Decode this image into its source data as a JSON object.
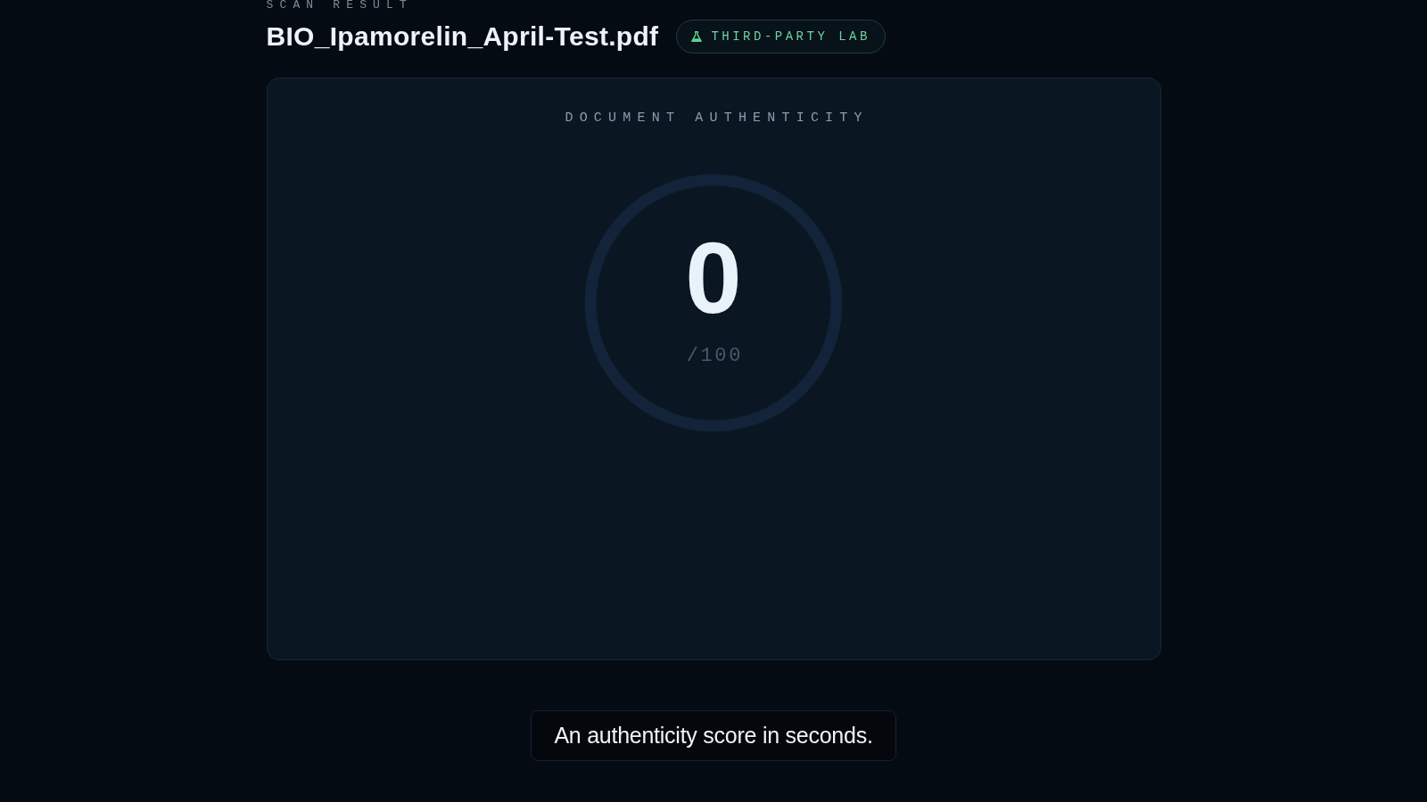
{
  "header": {
    "eyebrow": "SCAN RESULT",
    "file_name": "BIO_Ipamorelin_April-Test.pdf",
    "badge": {
      "label": "THIRD-PARTY LAB"
    }
  },
  "card": {
    "title": "DOCUMENT AUTHENTICITY",
    "gauge": {
      "score": "0",
      "max": "/100"
    }
  },
  "caption": "An authenticity score in seconds."
}
